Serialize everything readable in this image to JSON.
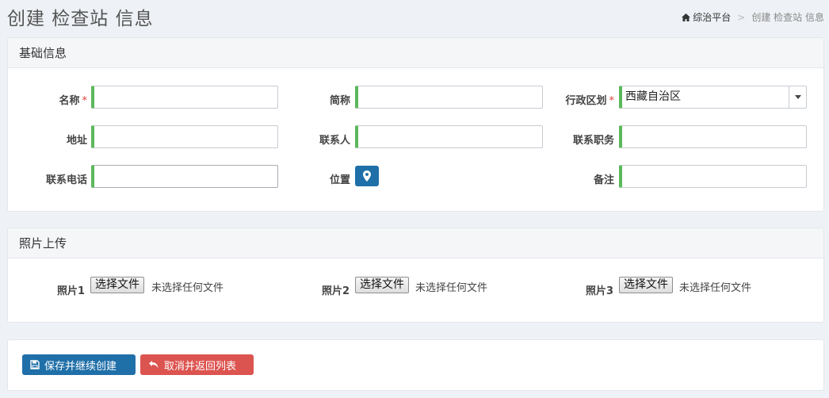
{
  "header": {
    "title": "创建 检查站 信息"
  },
  "breadcrumb": {
    "home": "综治平台",
    "current": "创建 检查站 信息"
  },
  "basic": {
    "title": "基础信息",
    "fields": {
      "name": {
        "label": "名称",
        "required": "*",
        "value": ""
      },
      "short_name": {
        "label": "简称",
        "value": ""
      },
      "region": {
        "label": "行政区划",
        "required": "*",
        "value": "西藏自治区"
      },
      "address": {
        "label": "地址",
        "value": ""
      },
      "contact": {
        "label": "联系人",
        "value": ""
      },
      "contact_title": {
        "label": "联系职务",
        "value": ""
      },
      "phone": {
        "label": "联系电话",
        "value": ""
      },
      "location": {
        "label": "位置"
      },
      "remark": {
        "label": "备注",
        "value": ""
      }
    }
  },
  "photos": {
    "title": "照片上传",
    "items": [
      {
        "label": "照片1",
        "button": "选择文件",
        "status": "未选择任何文件"
      },
      {
        "label": "照片2",
        "button": "选择文件",
        "status": "未选择任何文件"
      },
      {
        "label": "照片3",
        "button": "选择文件",
        "status": "未选择任何文件"
      }
    ]
  },
  "actions": {
    "save": "保存并继续创建",
    "cancel": "取消并返回列表"
  },
  "colors": {
    "primary": "#1f6fa8",
    "danger": "#dc5450",
    "valid": "#5cb85c",
    "required": "#e0413d"
  }
}
